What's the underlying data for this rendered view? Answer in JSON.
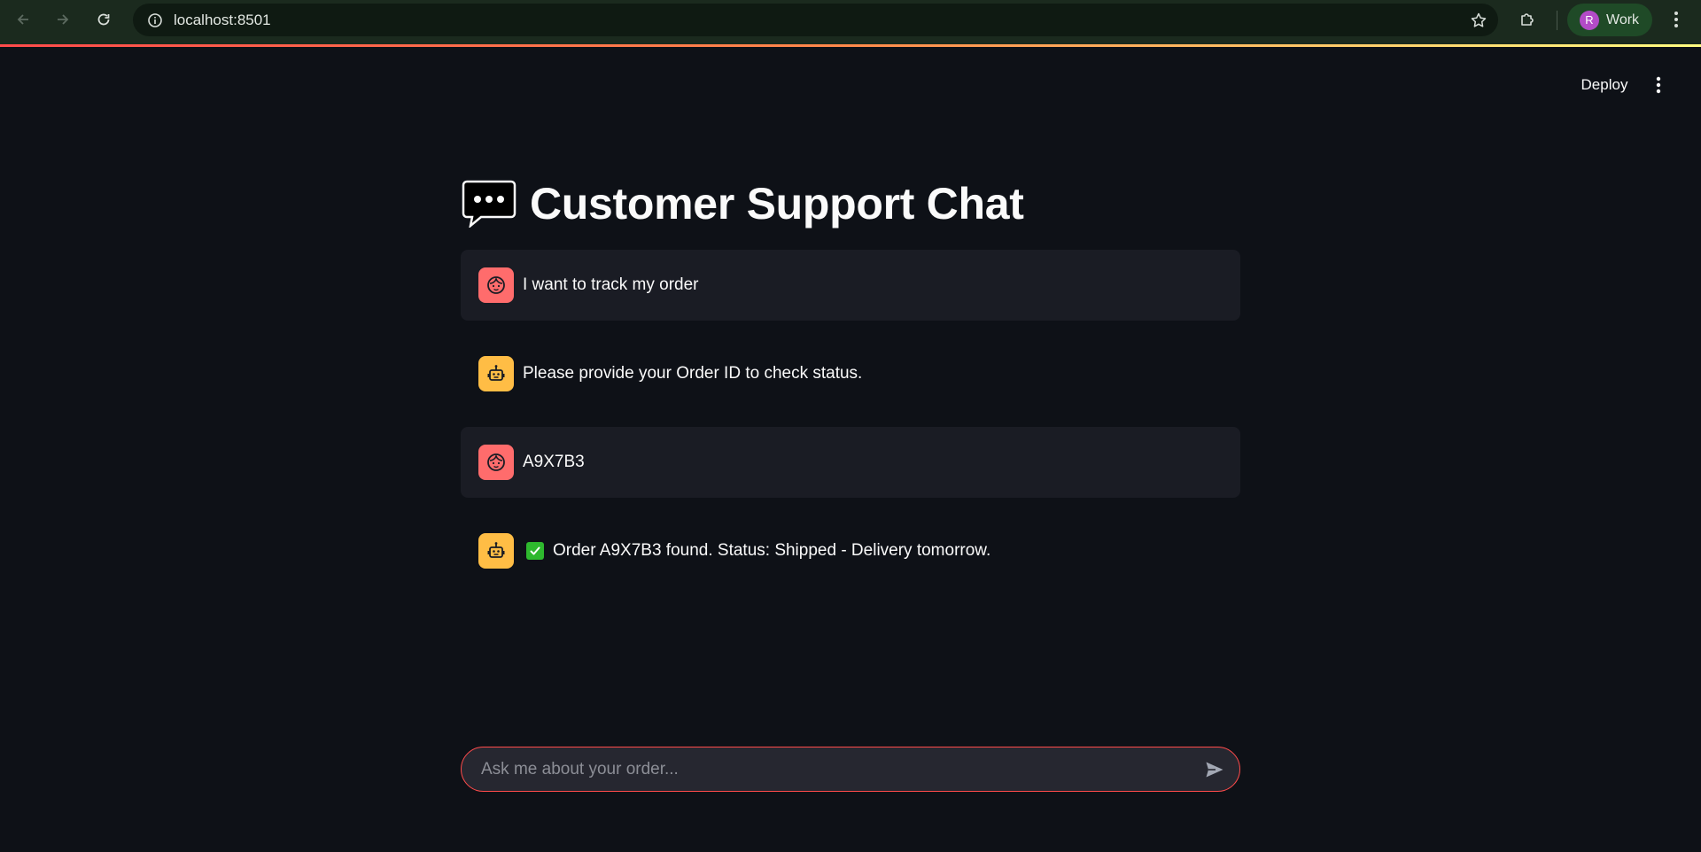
{
  "browser": {
    "url": "localhost:8501",
    "profile_initial": "R",
    "profile_name": "Work",
    "accent_colors": [
      "#ff4b4b",
      "#ff8a4b",
      "#fffd80"
    ]
  },
  "header": {
    "deploy_label": "Deploy"
  },
  "main": {
    "title_icon": "speech-balloon-icon",
    "title": "Customer Support Chat"
  },
  "messages": [
    {
      "role": "user",
      "avatar_icon": "user-face-icon",
      "text": "I want to track my order"
    },
    {
      "role": "assistant",
      "avatar_icon": "robot-icon",
      "text": "Please provide your Order ID to check status."
    },
    {
      "role": "user",
      "avatar_icon": "user-face-icon",
      "text": "A9X7B3"
    },
    {
      "role": "assistant",
      "avatar_icon": "robot-icon",
      "prefix_icon": "check-mark-icon",
      "text": "Order A9X7B3 found. Status: Shipped - Delivery tomorrow."
    }
  ],
  "chat_input": {
    "placeholder": "Ask me about your order...",
    "value": ""
  },
  "colors": {
    "background": "#0e1117",
    "user_message_bg": "#1a1c24",
    "user_avatar": "#ff6c6c",
    "assistant_avatar": "#ffbd45",
    "input_border": "#ff4b4b",
    "check_green": "#2eb82e"
  }
}
